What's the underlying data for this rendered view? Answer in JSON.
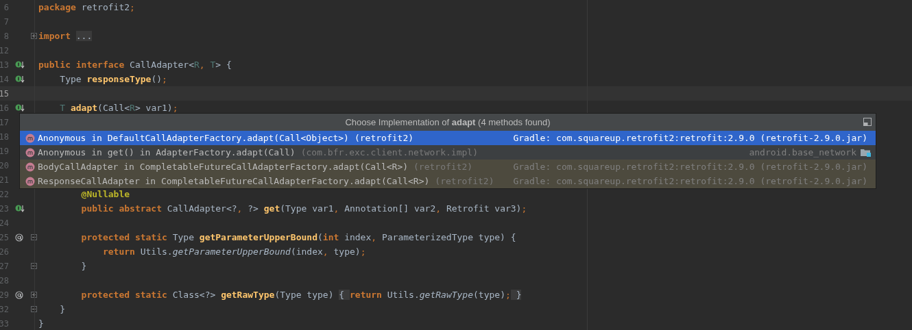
{
  "editor": {
    "lines": [
      {
        "number": "6",
        "current": false,
        "tokens": [
          {
            "kind": "keyword",
            "text": "package "
          },
          {
            "kind": "plain",
            "text": "retrofit2"
          },
          {
            "kind": "punct",
            "text": ";"
          }
        ]
      },
      {
        "number": "7",
        "current": false
      },
      {
        "number": "8",
        "collapsed": true,
        "current": false,
        "tokens": [
          {
            "kind": "keyword",
            "text": "import "
          },
          {
            "kind": "folded",
            "text": "..."
          }
        ]
      },
      {
        "number": "12",
        "current": false
      },
      {
        "number": "13",
        "implemented": true,
        "current": false,
        "tokens": [
          {
            "kind": "keyword",
            "text": "public interface "
          },
          {
            "kind": "plain",
            "text": "CallAdapter<"
          },
          {
            "kind": "typeparam",
            "text": "R"
          },
          {
            "kind": "punct",
            "text": ", "
          },
          {
            "kind": "typeparam",
            "text": "T"
          },
          {
            "kind": "plain",
            "text": "> {"
          }
        ]
      },
      {
        "number": "14",
        "implemented": true,
        "current": false,
        "tokens": [
          {
            "kind": "plain",
            "text": "    Type "
          },
          {
            "kind": "method",
            "text": "responseType"
          },
          {
            "kind": "plain",
            "text": "()"
          },
          {
            "kind": "punct",
            "text": ";"
          }
        ]
      },
      {
        "number": "15",
        "current": true
      },
      {
        "number": "16",
        "implemented": true,
        "current": false,
        "tokens": [
          {
            "kind": "typeparam",
            "text": "    T "
          },
          {
            "kind": "method",
            "text": "adapt"
          },
          {
            "kind": "plain",
            "text": "(Call<"
          },
          {
            "kind": "typeparam",
            "text": "R"
          },
          {
            "kind": "plain",
            "text": "> var1)"
          },
          {
            "kind": "punct",
            "text": ";"
          }
        ]
      },
      {
        "number": "17",
        "current": false
      },
      {
        "number": "18",
        "current": false
      },
      {
        "number": "19",
        "current": false
      },
      {
        "number": "20",
        "current": false
      },
      {
        "number": "21",
        "current": false
      },
      {
        "number": "22",
        "current": false,
        "tokens": [
          {
            "kind": "annotation",
            "text": "        @Nullable"
          }
        ]
      },
      {
        "number": "23",
        "implemented": true,
        "current": false,
        "tokens": [
          {
            "kind": "keyword",
            "text": "        public abstract "
          },
          {
            "kind": "plain",
            "text": "CallAdapter<?"
          },
          {
            "kind": "punct",
            "text": ", "
          },
          {
            "kind": "plain",
            "text": "?> "
          },
          {
            "kind": "method",
            "text": "get"
          },
          {
            "kind": "plain",
            "text": "(Type var1"
          },
          {
            "kind": "punct",
            "text": ", "
          },
          {
            "kind": "plain",
            "text": "Annotation[] var2"
          },
          {
            "kind": "punct",
            "text": ", "
          },
          {
            "kind": "plain",
            "text": "Retrofit var3)"
          },
          {
            "kind": "punct",
            "text": ";"
          }
        ]
      },
      {
        "number": "24",
        "current": false
      },
      {
        "number": "25",
        "annotated": true,
        "fold_start": true,
        "current": false,
        "tokens": [
          {
            "kind": "keyword",
            "text": "        protected static "
          },
          {
            "kind": "plain",
            "text": "Type "
          },
          {
            "kind": "method",
            "text": "getParameterUpperBound"
          },
          {
            "kind": "plain",
            "text": "("
          },
          {
            "kind": "keyword",
            "text": "int "
          },
          {
            "kind": "plain",
            "text": "index"
          },
          {
            "kind": "punct",
            "text": ", "
          },
          {
            "kind": "plain",
            "text": "ParameterizedType type) {"
          }
        ]
      },
      {
        "number": "26",
        "current": false,
        "tokens": [
          {
            "kind": "keyword",
            "text": "            return "
          },
          {
            "kind": "plain",
            "text": "Utils."
          },
          {
            "kind": "static",
            "text": "getParameterUpperBound"
          },
          {
            "kind": "plain",
            "text": "(index"
          },
          {
            "kind": "punct",
            "text": ", "
          },
          {
            "kind": "plain",
            "text": "type)"
          },
          {
            "kind": "punct",
            "text": ";"
          }
        ]
      },
      {
        "number": "27",
        "fold_end": true,
        "current": false,
        "tokens": [
          {
            "kind": "plain",
            "text": "        }"
          }
        ]
      },
      {
        "number": "28",
        "current": false
      },
      {
        "number": "29",
        "annotated": true,
        "collapsed": true,
        "current": false,
        "tokens": [
          {
            "kind": "keyword",
            "text": "        protected static "
          },
          {
            "kind": "plain",
            "text": "Class<?> "
          },
          {
            "kind": "method",
            "text": "getRawType"
          },
          {
            "kind": "plain",
            "text": "(Type type) "
          },
          {
            "kind": "folded",
            "text": "{ "
          },
          {
            "kind": "keyword",
            "text": "return "
          },
          {
            "kind": "plain",
            "text": "Utils."
          },
          {
            "kind": "static",
            "text": "getRawType"
          },
          {
            "kind": "plain",
            "text": "(type)"
          },
          {
            "kind": "punct",
            "text": ";"
          },
          {
            "kind": "folded",
            "text": " }"
          }
        ]
      },
      {
        "number": "32",
        "fold_end": true,
        "current": false,
        "tokens": [
          {
            "kind": "plain",
            "text": "    }"
          }
        ]
      },
      {
        "number": "33",
        "current": false,
        "tokens": [
          {
            "kind": "plain",
            "text": "}"
          }
        ]
      }
    ]
  },
  "popup": {
    "title": "Choose Implementation of **adapt** (4 methods found)",
    "rows": [
      {
        "selected": true,
        "kind": "library",
        "name": "Anonymous in DefaultCallAdapterFactory.adapt(Call<Object>)",
        "context": "(retrofit2)",
        "location": "Gradle: com.squareup.retrofit2:retrofit:2.9.0 (retrofit-2.9.0.jar)"
      },
      {
        "selected": false,
        "kind": "module",
        "name": "Anonymous in get() in AdapterFactory.adapt(Call)",
        "context": "(com.bfr.exc.client.network.impl)",
        "location": "android.base_network"
      },
      {
        "selected": false,
        "kind": "library",
        "name": "BodyCallAdapter in CompletableFutureCallAdapterFactory.adapt(Call<R>)",
        "context": "(retrofit2)",
        "location": "Gradle: com.squareup.retrofit2:retrofit:2.9.0 (retrofit-2.9.0.jar)"
      },
      {
        "selected": false,
        "kind": "library",
        "name": "ResponseCallAdapter in CompletableFutureCallAdapterFactory.adapt(Call<R>)",
        "context": "(retrofit2)",
        "location": "Gradle: com.squareup.retrofit2:retrofit:2.9.0 (retrofit-2.9.0.jar)"
      }
    ]
  }
}
